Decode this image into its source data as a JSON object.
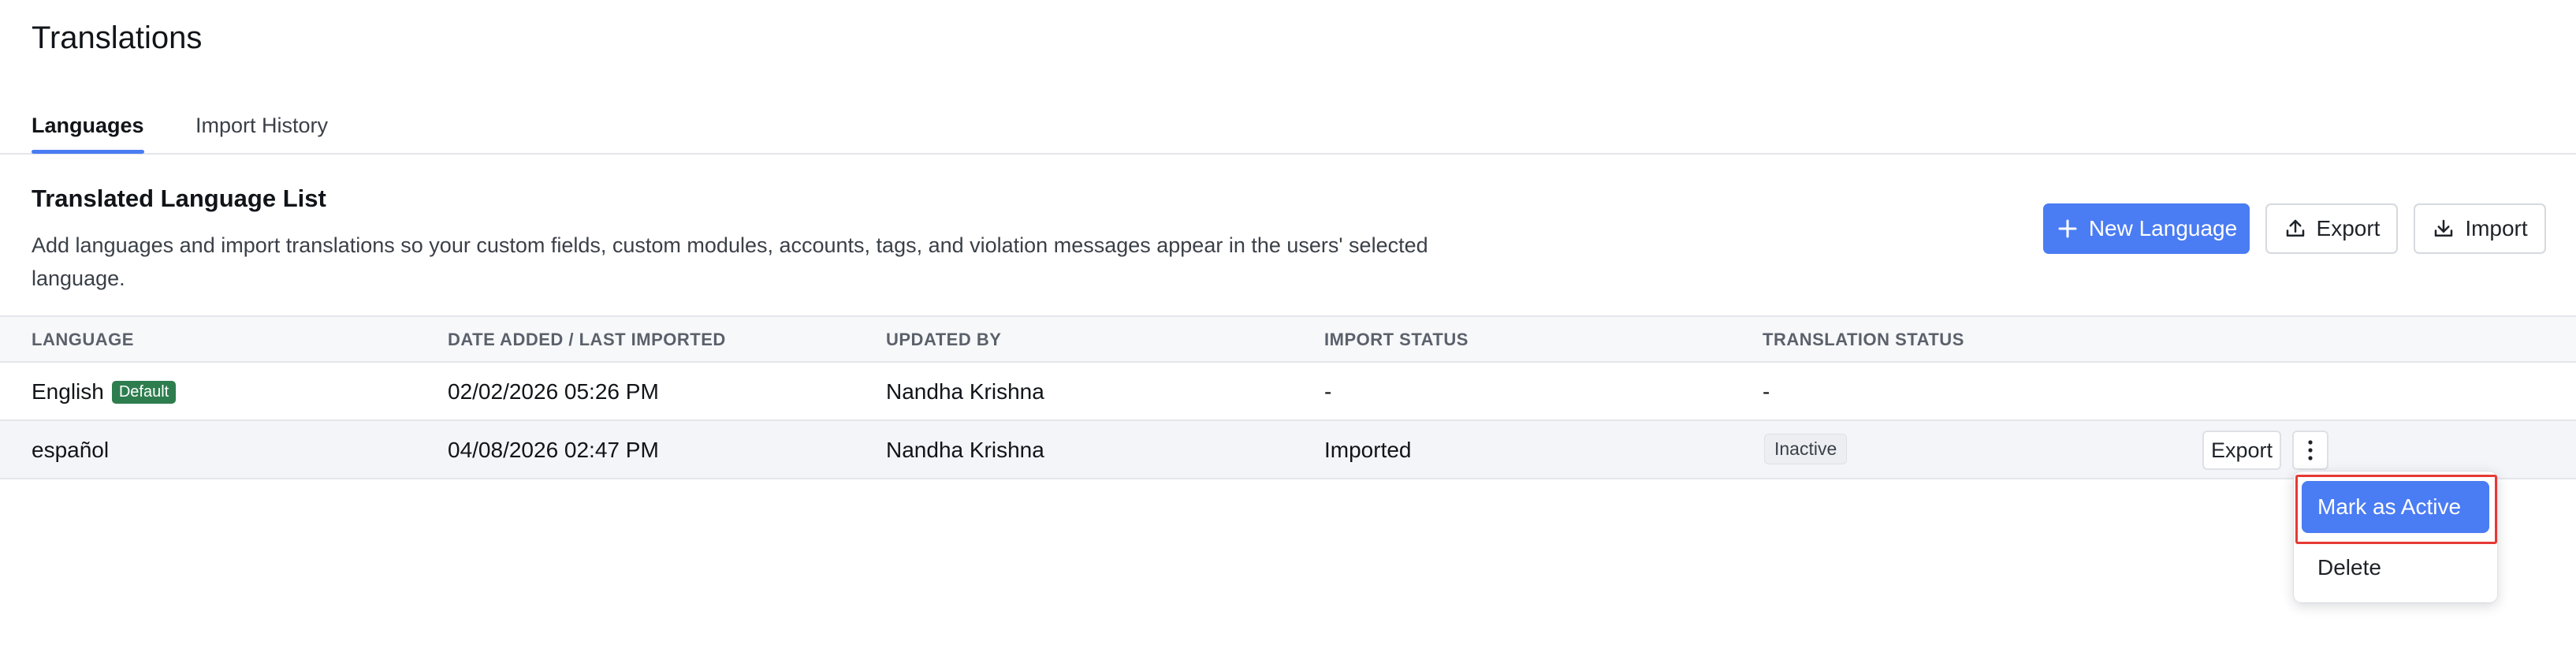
{
  "page": {
    "title": "Translations"
  },
  "tabs": [
    {
      "label": "Languages",
      "active": true
    },
    {
      "label": "Import History",
      "active": false
    }
  ],
  "section": {
    "title": "Translated Language List",
    "description": "Add languages and import translations so your custom fields, custom modules, accounts, tags, and violation messages appear in the users' selected language."
  },
  "toolbar": {
    "new_language_label": "New Language",
    "export_label": "Export",
    "import_label": "Import"
  },
  "table": {
    "headers": [
      "LANGUAGE",
      "DATE ADDED / LAST IMPORTED",
      "UPDATED BY",
      "IMPORT STATUS",
      "TRANSLATION STATUS"
    ],
    "rows": [
      {
        "language": "English",
        "badge": "Default",
        "date": "02/02/2026 05:26 PM",
        "updated_by": "Nandha Krishna",
        "import_status": "-",
        "translation_status": "-"
      },
      {
        "language": "español",
        "date": "04/08/2026 02:47 PM",
        "updated_by": "Nandha Krishna",
        "import_status": "Imported",
        "translation_status": "Inactive",
        "export_label": "Export"
      }
    ]
  },
  "row_menu": {
    "items": [
      {
        "label": "Mark as Active",
        "highlighted": true
      },
      {
        "label": "Delete",
        "highlighted": false
      }
    ]
  },
  "colors": {
    "accent": "#4a7cf3",
    "default_badge": "#2e7d4f",
    "highlight_outline": "#e53935"
  },
  "icons": {
    "new_language": "plus-icon",
    "export": "upload-icon",
    "import": "download-icon",
    "row_menu": "kebab-icon"
  }
}
